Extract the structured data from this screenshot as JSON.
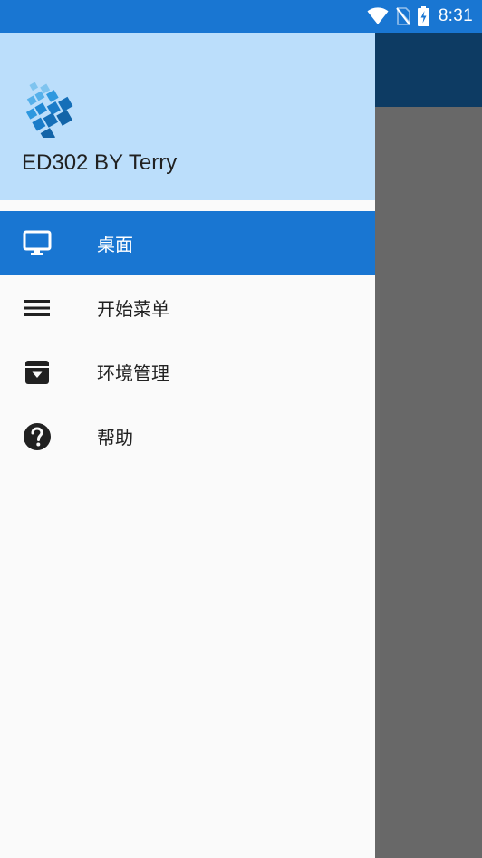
{
  "status_bar": {
    "time": "8:31",
    "icons": [
      "wifi-icon",
      "no-sim-icon",
      "battery-charging-icon"
    ]
  },
  "drawer": {
    "title": "ED302 BY Terry",
    "logo": "app-logo-icon",
    "items": [
      {
        "label": "桌面",
        "icon": "monitor-icon",
        "active": true
      },
      {
        "label": "开始菜单",
        "icon": "menu-icon",
        "active": false
      },
      {
        "label": "环境管理",
        "icon": "archive-icon",
        "active": false
      },
      {
        "label": "帮助",
        "icon": "help-circle-icon",
        "active": false
      }
    ]
  },
  "colors": {
    "primary": "#1976d2",
    "primary_dark": "#0d3b63",
    "header_bg": "#bbdefb",
    "drawer_bg": "#fafafa",
    "scrim": "#686868"
  }
}
